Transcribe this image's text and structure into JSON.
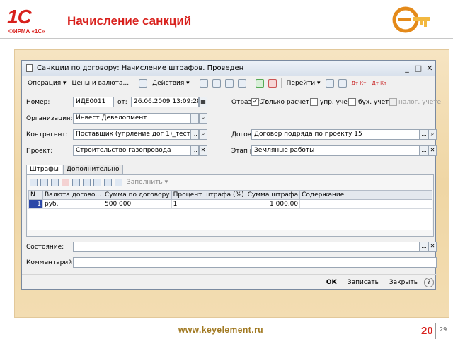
{
  "slide": {
    "logo_text": "1С",
    "logo_sub": "ФИРМА «1С»",
    "title": "Начисление санкций",
    "url": "www.keyelement.ru",
    "page_number": "20",
    "page_number_small": "29"
  },
  "window": {
    "title": "Санкции по договору: Начисление штрафов. Проведен",
    "controls": {
      "minimize": "_",
      "maximize": "□",
      "close": "✕"
    }
  },
  "toolbar": {
    "operation": "Операция ▾",
    "prices": "Цены и валюта...",
    "actions": "Действия ▾",
    "go": "Перейти ▾",
    "dt_kt": "Дт Кт",
    "dt_kt_n": "Дт Кт"
  },
  "form": {
    "number_label": "Номер:",
    "number_value": "ИДЕ0011",
    "from_label": "от:",
    "date_value": "26.06.2009 13:09:28",
    "reflect_label": "Отразить в:",
    "only_calc_label": "Только расчет",
    "only_calc_checked": "✓",
    "mgmt_label": "упр. учете",
    "acc_label": "бух. учете",
    "tax_label": "налог. учете",
    "org_label": "Организация:",
    "org_value": "Инвест Девелопмент",
    "contractor_label": "Контрагент:",
    "contractor_value": "Поставщик (упрление дог 1)_тест1",
    "contract_label": "Договор:",
    "contract_value": "Договор подряда по проекту 15",
    "project_label": "Проект:",
    "project_value": "Строительство газопровода",
    "stage_label": "Этап работ:",
    "stage_value": "Земляные работы",
    "status_label": "Состояние:",
    "status_value": "",
    "comment_label": "Комментарий:",
    "comment_value": ""
  },
  "tabs": [
    {
      "label": "Штрафы"
    },
    {
      "label": "Дополнительно"
    }
  ],
  "grid": {
    "fill_label": "Заполнить ▾",
    "columns": [
      "N",
      "Валюта догово...",
      "Сумма по договору",
      "Процент штрафа (%)",
      "Сумма штрафа",
      "Содержание"
    ],
    "rows": [
      {
        "n": "1",
        "currency": "руб.",
        "contract_sum": "500 000",
        "percent": "1",
        "penalty_sum": "1 000,00",
        "content": ""
      }
    ]
  },
  "bottom": {
    "ok": "ОК",
    "save": "Записать",
    "close": "Закрыть",
    "help": "?"
  },
  "colors": {
    "brand_red": "#d8201c",
    "frame_bg": "#efd6a4",
    "selection": "#2c48a8"
  }
}
